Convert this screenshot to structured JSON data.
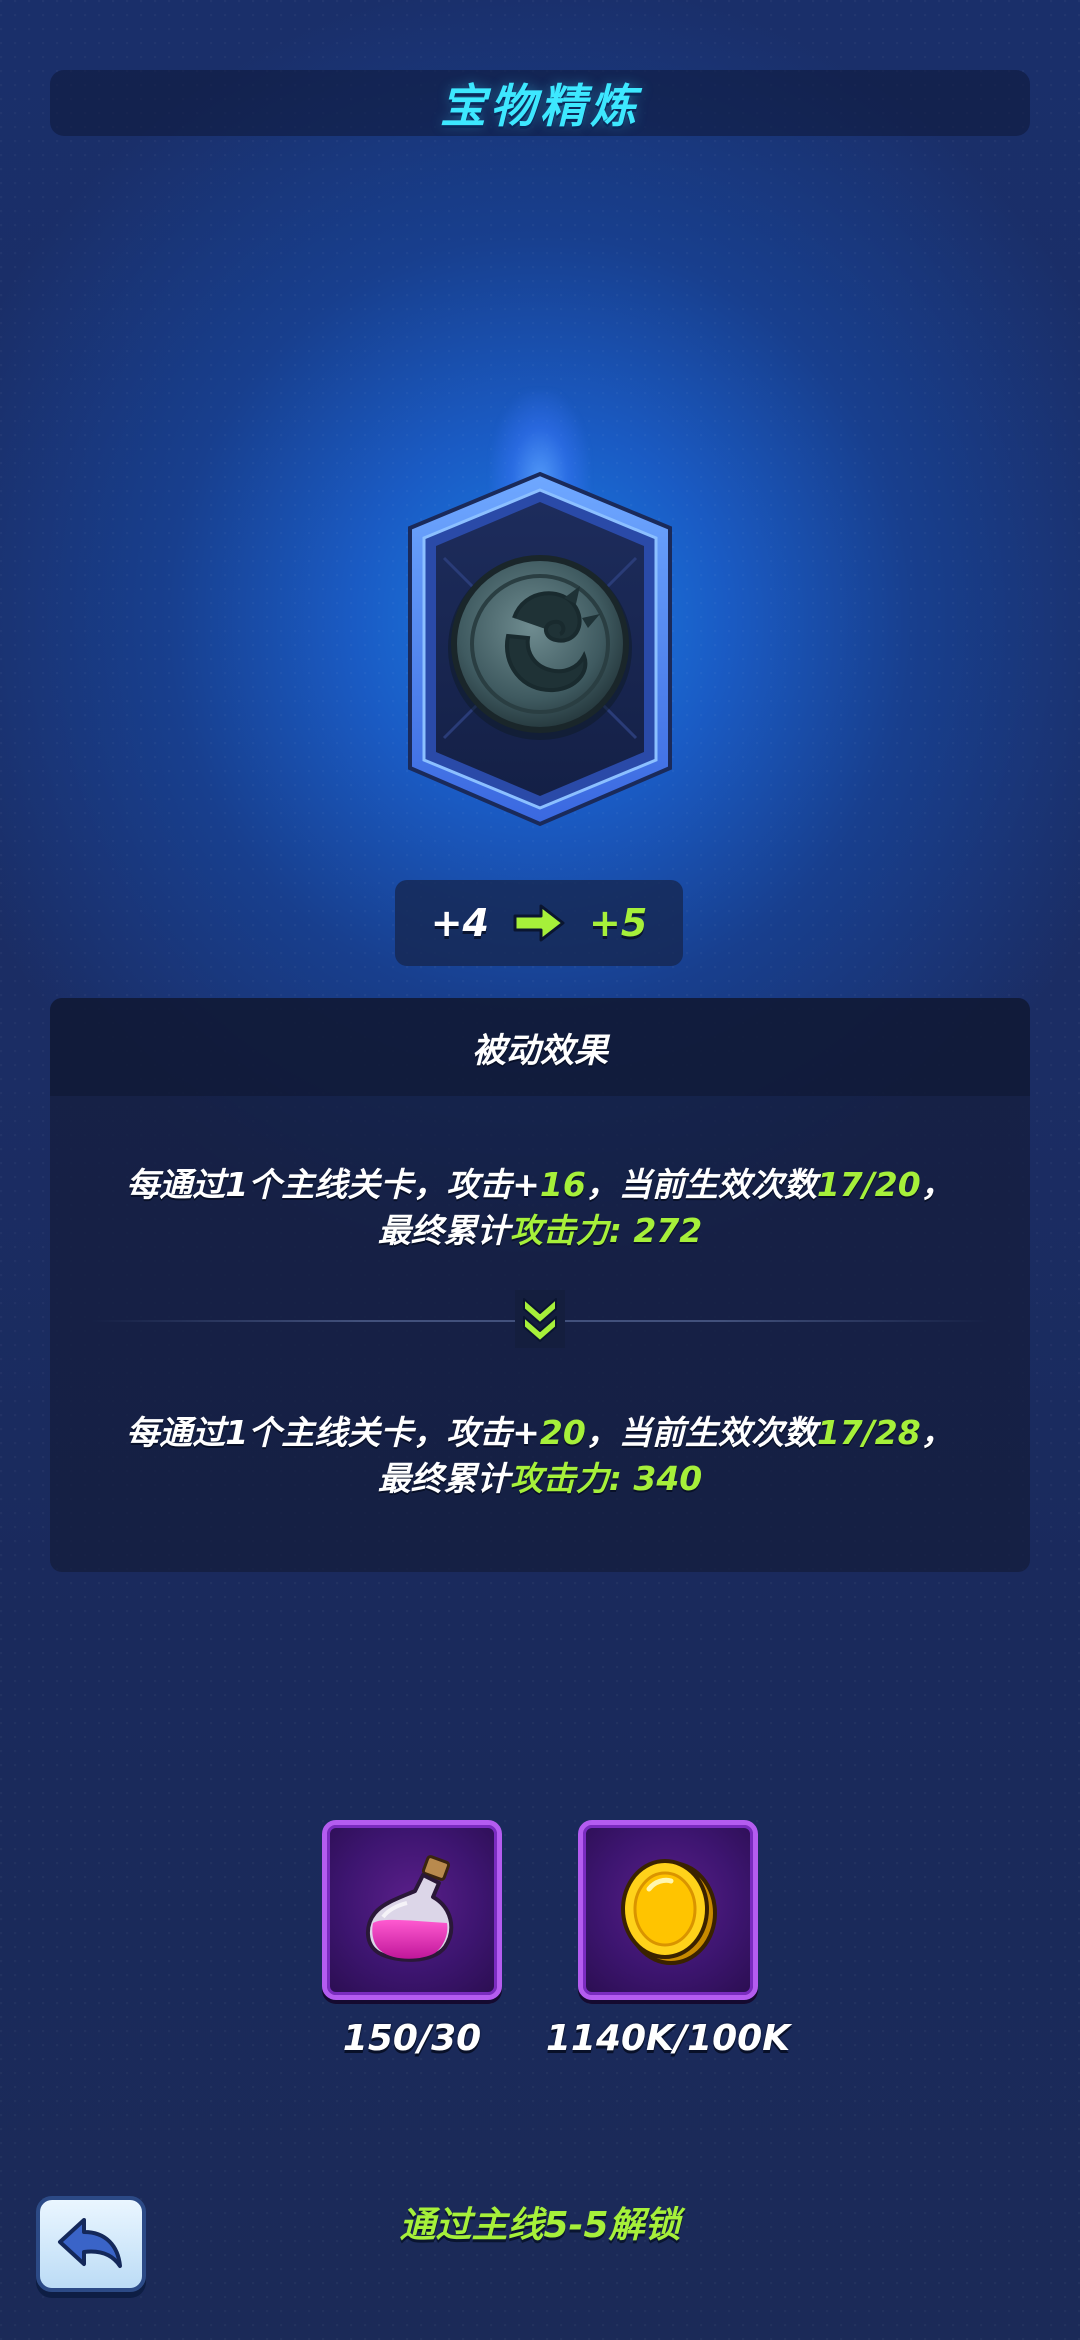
{
  "header": {
    "title": "宝物精炼"
  },
  "treasure": {
    "icon": "dragon-medallion-icon",
    "level_from": "+4",
    "level_to": "+5"
  },
  "effect": {
    "title": "被动效果",
    "current": {
      "p1": "每通过1个主线关卡，攻击+",
      "atk": "16",
      "p2": "，当前生效次数",
      "count": "17/20",
      "p3": "，",
      "p4": "最终累计",
      "total_label": "攻击力: 272"
    },
    "next": {
      "p1": "每通过1个主线关卡，攻击+",
      "atk": "20",
      "p2": "，当前生效次数",
      "count": "17/28",
      "p3": "，",
      "p4": "最终累计",
      "total_label": "攻击力: 340"
    }
  },
  "costs": [
    {
      "icon": "potion-flask-icon",
      "amount": "150/30"
    },
    {
      "icon": "gold-coin-icon",
      "amount": "1140K/100K"
    }
  ],
  "footer": {
    "unlock_text": "通过主线5-5解锁",
    "back_icon": "back-arrow-icon"
  },
  "colors": {
    "title": "#3de8ff",
    "highlight_green": "#a6f03a",
    "item_frame_purple": "#b45cf0"
  }
}
